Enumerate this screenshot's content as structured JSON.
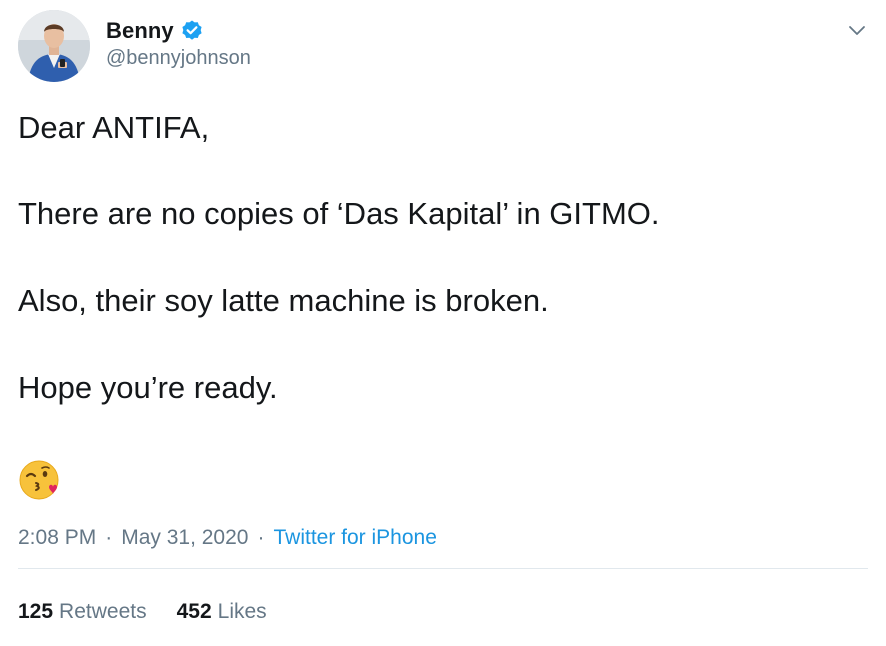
{
  "author": {
    "display_name": "Benny",
    "handle": "@bennyjohnson",
    "verified": true
  },
  "tweet": {
    "lines": [
      "Dear ANTIFA,",
      "There are no copies of ‘Das Kapital’ in GITMO.",
      "Also, their soy latte machine is broken.",
      "Hope you’re ready."
    ],
    "emoji": "kissing-face-with-heart-emoji"
  },
  "meta": {
    "time": "2:08 PM",
    "separator": "·",
    "date": "May 31, 2020",
    "source": "Twitter for iPhone"
  },
  "stats": {
    "retweets_count": "125",
    "retweets_label": "Retweets",
    "likes_count": "452",
    "likes_label": "Likes"
  },
  "icons": {
    "verified": "verified-badge-icon",
    "menu": "chevron-down-icon"
  },
  "colors": {
    "text": "#14171a",
    "secondary": "#657786",
    "link": "#1b95e0",
    "verified": "#1da1f2",
    "divider": "#e1e8ed"
  }
}
